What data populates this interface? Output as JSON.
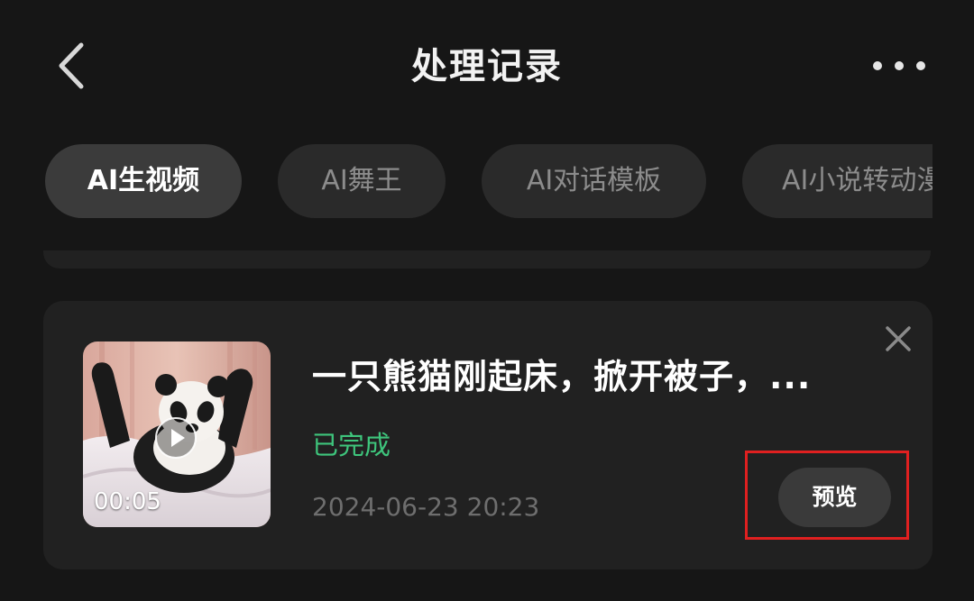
{
  "header": {
    "title": "处理记录",
    "back_icon": "chevron-left-icon",
    "more_icon": "more-horizontal-icon"
  },
  "tabs": [
    {
      "label": "AI生视频",
      "active": true
    },
    {
      "label": "AI舞王",
      "active": false
    },
    {
      "label": "AI对话模板",
      "active": false
    },
    {
      "label": "AI小说转动漫",
      "active": false
    }
  ],
  "record": {
    "title": "一只熊猫刚起床，掀开被子，...",
    "status": "已完成",
    "timestamp": "2024-06-23 20:23",
    "duration": "00:05",
    "preview_label": "预览",
    "close_icon": "close-icon",
    "play_icon": "play-icon"
  },
  "colors": {
    "background": "#161616",
    "card": "#212121",
    "status_green": "#3ec57c",
    "highlight_red": "#e02020"
  }
}
